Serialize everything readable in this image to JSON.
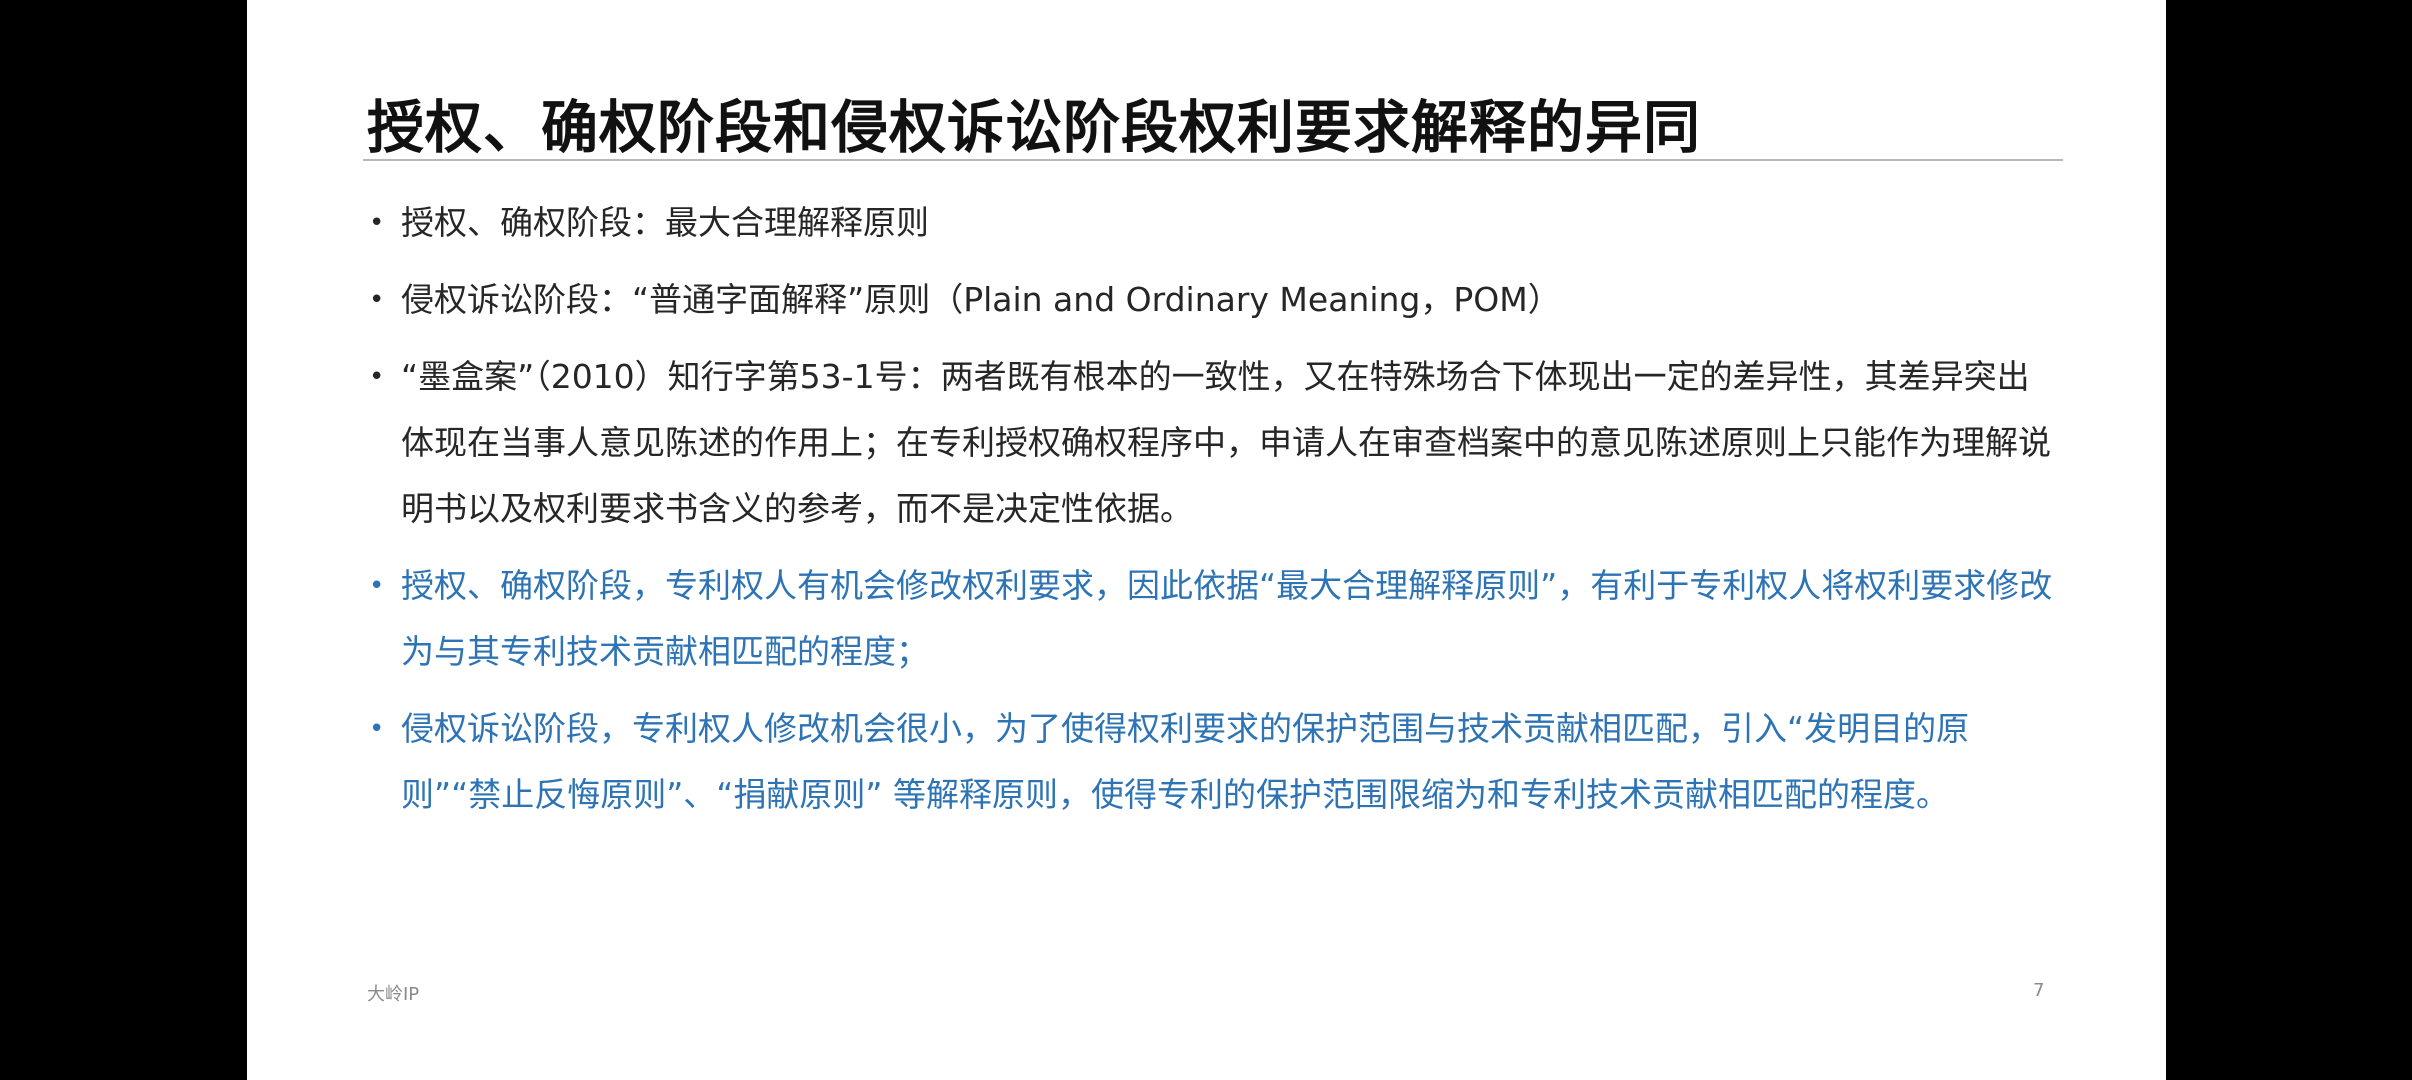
{
  "slide": {
    "title": "授权、确权阶段和侵权诉讼阶段权利要求解释的异同",
    "bullet_symbol": "•",
    "bullets": [
      {
        "text": "授权、确权阶段：最大合理解释原则",
        "color": "#262626"
      },
      {
        "text": "侵权诉讼阶段：“普通字面解释”原则（Plain and Ordinary Meaning，POM）",
        "color": "#262626"
      },
      {
        "text": "“墨盒案”（2010）知行字第53-1号：两者既有根本的一致性，又在特殊场合下体现出一定的差异性，其差异突出体现在当事人意见陈述的作用上；在专利授权确权程序中，申请人在审查档案中的意见陈述原则上只能作为理解说明书以及权利要求书含义的参考，而不是决定性依据。",
        "color": "#262626"
      },
      {
        "text": "授权、确权阶段，专利权人有机会修改权利要求，因此依据“最大合理解释原则”，有利于专利权人将权利要求修改为与其专利技术贡献相匹配的程度；",
        "color": "#2e74b5"
      },
      {
        "text": "侵权诉讼阶段，专利权人修改机会很小，为了使得权利要求的保护范围与技术贡献相匹配，引入“发明目的原则”“禁止反悔原则”、“捐献原则” 等解释原则，使得专利的保护范围限缩为和专利技术贡献相匹配的程度。",
        "color": "#2e74b5"
      }
    ],
    "footer": {
      "source": "大岭IP",
      "page_number": "7"
    }
  }
}
